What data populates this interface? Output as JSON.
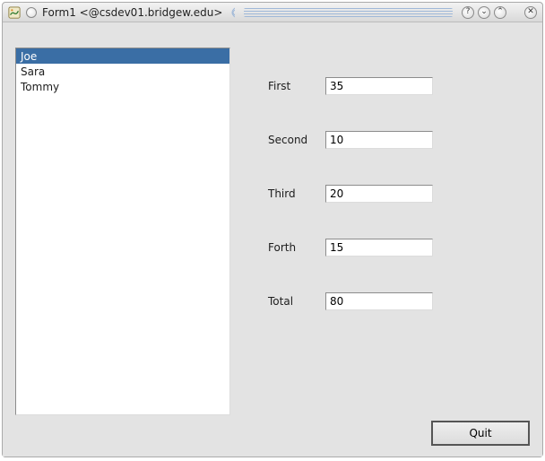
{
  "window": {
    "title": "Form1 <@csdev01.bridgew.edu>",
    "help_glyph": "?",
    "min_glyph": "⌄",
    "up_glyph": "⌃",
    "close_glyph": "✕"
  },
  "list": {
    "items": [
      {
        "name": "Joe",
        "selected": true
      },
      {
        "name": "Sara",
        "selected": false
      },
      {
        "name": "Tommy",
        "selected": false
      }
    ]
  },
  "form": {
    "first": {
      "label": "First",
      "value": "35"
    },
    "second": {
      "label": "Second",
      "value": "10"
    },
    "third": {
      "label": "Third",
      "value": "20"
    },
    "forth": {
      "label": "Forth",
      "value": "15"
    },
    "total": {
      "label": "Total",
      "value": "80"
    }
  },
  "buttons": {
    "quit": "Quit"
  }
}
